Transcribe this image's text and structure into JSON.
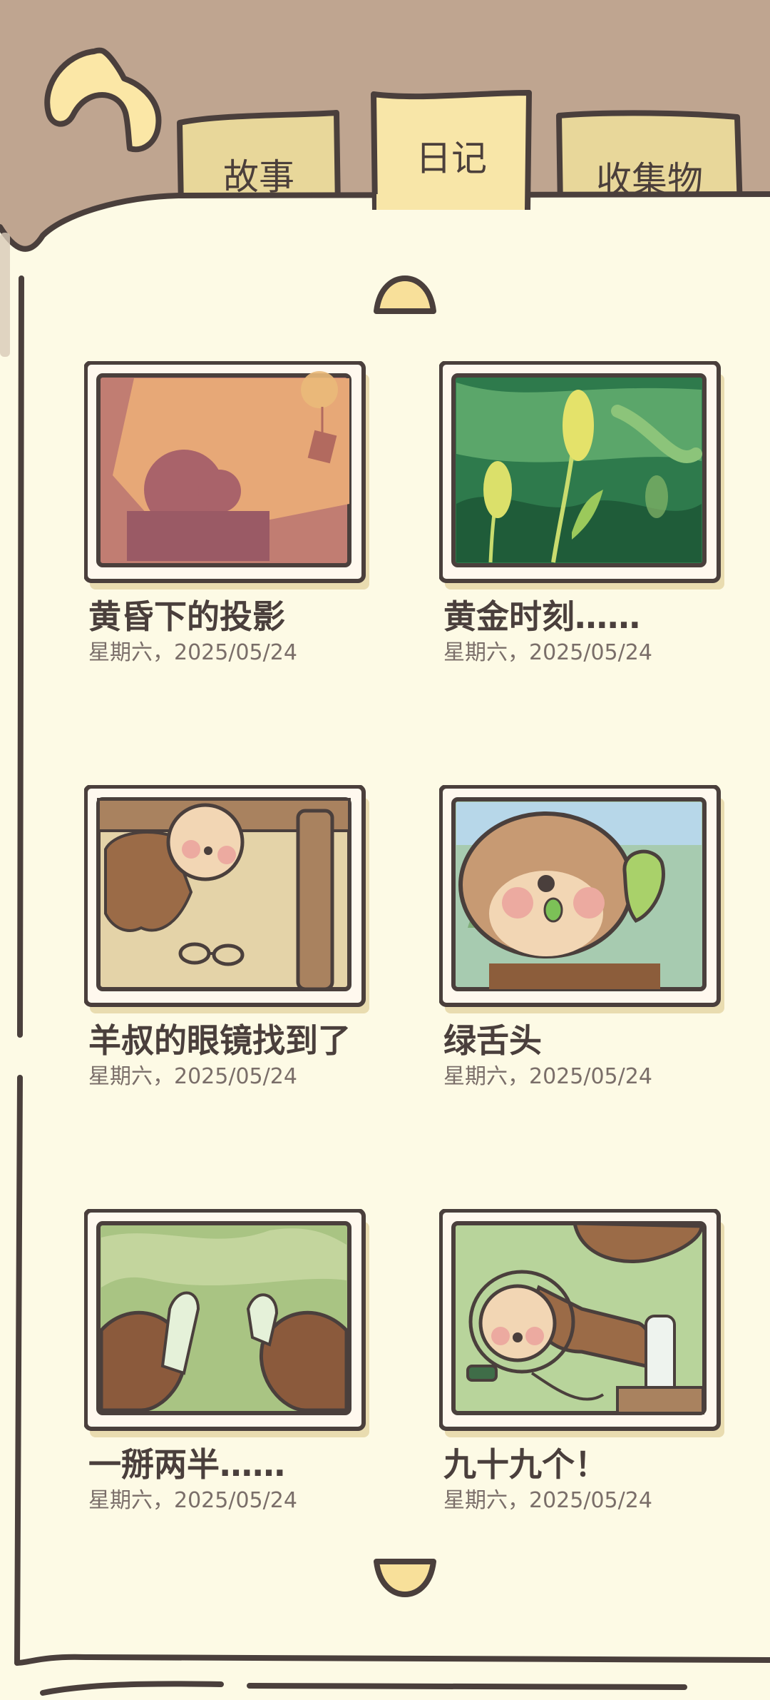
{
  "tabs": [
    {
      "label": "故事",
      "active": false
    },
    {
      "label": "日记",
      "active": true
    },
    {
      "label": "收集物",
      "active": false
    }
  ],
  "diary_entries": [
    {
      "title": "黄昏下的投影",
      "date": "星期六，2025/05/24",
      "picture": "shadow-at-dusk"
    },
    {
      "title": "黄金时刻……",
      "date": "星期六，2025/05/24",
      "picture": "foxtail-grass"
    },
    {
      "title": "羊叔的眼镜找到了",
      "date": "星期六，2025/05/24",
      "picture": "chipmunk-finds-glasses"
    },
    {
      "title": "绿舌头",
      "date": "星期六，2025/05/24",
      "picture": "chipmunk-green-popsicle"
    },
    {
      "title": "一掰两半……",
      "date": "星期六，2025/05/24",
      "picture": "breaking-ice-pop"
    },
    {
      "title": "九十九个！",
      "date": "星期六，2025/05/24",
      "picture": "chipmunk-in-bottle"
    }
  ],
  "colors": {
    "background": "#bfa590",
    "page": "#fdfae5",
    "tab": "#e8d79a",
    "tab_active": "#f8e6a8",
    "outline": "#4a3f3c"
  },
  "icons": {
    "back": "back-arrow-icon",
    "scroll_up": "chevron-up-icon",
    "scroll_down": "chevron-down-icon"
  }
}
